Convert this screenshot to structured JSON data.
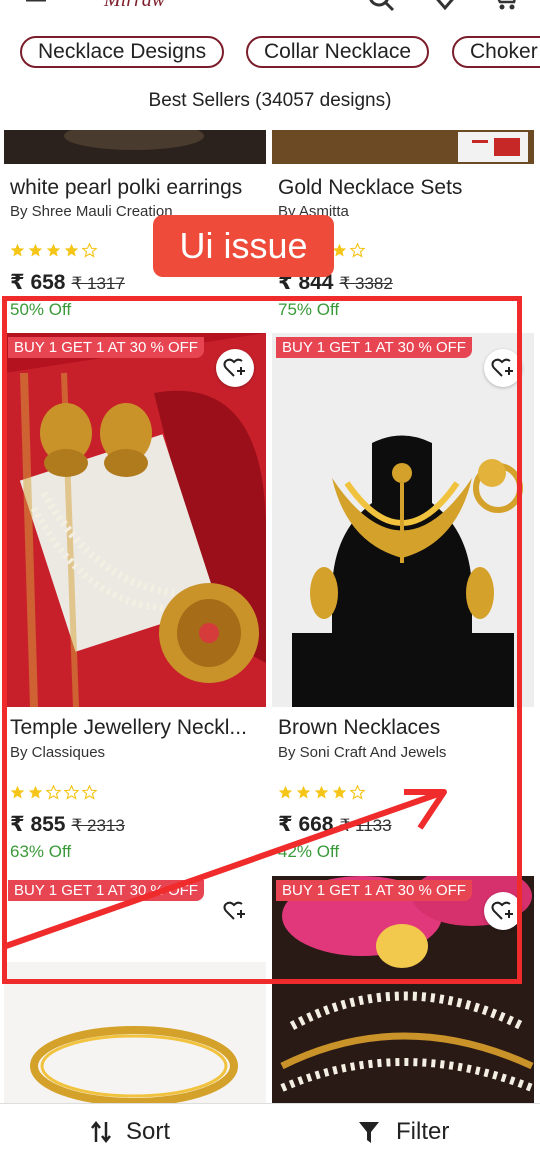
{
  "header": {
    "logo_text": "Mirraw"
  },
  "chips": [
    "Necklace Designs",
    "Collar Necklace",
    "Choker"
  ],
  "listing": {
    "count_text": "Best Sellers (34057 designs)"
  },
  "products": [
    {
      "title": "white pearl polki earrings",
      "brand": "By Shree Mauli Creation",
      "rating": 4,
      "price": "₹ 658",
      "mrp": "₹ 1317",
      "discount": "50% Off",
      "badge": ""
    },
    {
      "title": "Gold Necklace Sets",
      "brand": "By Asmitta",
      "rating": 4,
      "price": "₹ 844",
      "mrp": "₹ 3382",
      "discount": "75% Off",
      "badge": ""
    },
    {
      "title": "Temple Jewellery Neckl...",
      "brand": "By Classiques",
      "rating": 2,
      "price": "₹ 855",
      "mrp": "₹ 2313",
      "discount": "63% Off",
      "badge": "BUY 1 GET 1 AT 30 % OFF"
    },
    {
      "title": "Brown Necklaces",
      "brand": "By Soni Craft And Jewels",
      "rating": 4,
      "price": "₹ 668",
      "mrp": "₹ 1133",
      "discount": "42% Off",
      "badge": "BUY 1 GET 1 AT 30 % OFF"
    },
    {
      "badge": "BUY 1 GET 1 AT 30 % OFF"
    },
    {
      "badge": "BUY 1 GET 1 AT 30 % OFF"
    }
  ],
  "annotation": {
    "label": "Ui issue"
  },
  "bottom_bar": {
    "sort_label": "Sort",
    "filter_label": "Filter"
  },
  "colors": {
    "brand": "#7b1d2a",
    "badge": "#e84553",
    "discount": "#3a9a3a",
    "star": "#f5c518",
    "annotation": "#ef2b2b"
  },
  "icons": [
    "back-arrow-icon",
    "search-icon",
    "heart-icon",
    "cart-icon",
    "wishlist-add-icon",
    "star-icon",
    "sort-icon",
    "filter-icon"
  ]
}
